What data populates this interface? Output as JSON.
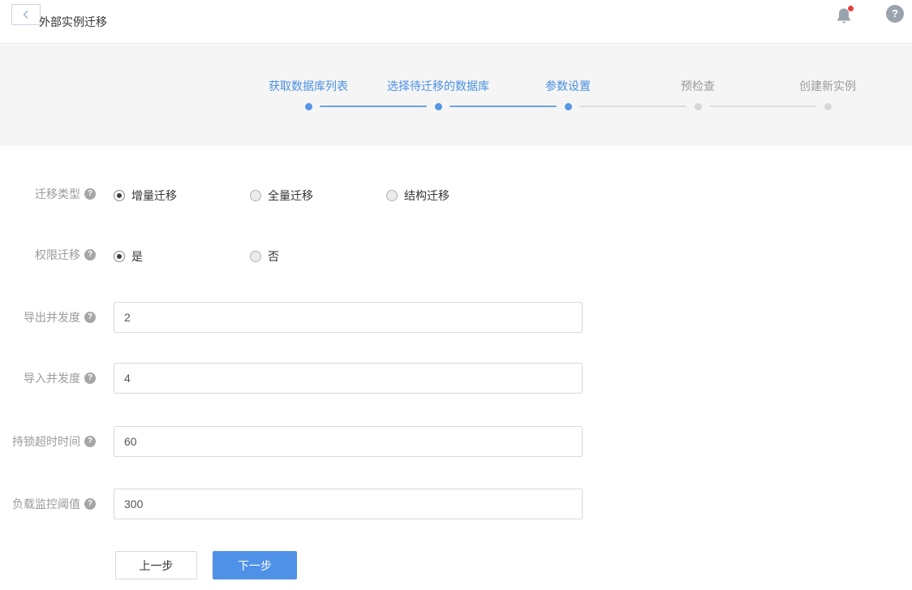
{
  "header": {
    "title": "外部实例迁移"
  },
  "icons": {
    "question_glyph": "?"
  },
  "colors": {
    "accent_blue": "#4a90e2",
    "step_inactive_gray": "#d6d6d6",
    "band_background": "#f5f5f6",
    "next_button_blue": "#5091e8",
    "notification_badge_red": "#e8413c"
  },
  "stepper": {
    "steps": [
      {
        "label": "获取数据库列表",
        "state": "active"
      },
      {
        "label": "选择待迁移的数据库",
        "state": "active"
      },
      {
        "label": "参数设置",
        "state": "active"
      },
      {
        "label": "预检查",
        "state": "pending"
      },
      {
        "label": "创建新实例",
        "state": "pending"
      }
    ]
  },
  "form": {
    "migration_type": {
      "label": "迁移类型",
      "options": [
        {
          "label": "增量迁移",
          "selected": true
        },
        {
          "label": "全量迁移",
          "selected": false
        },
        {
          "label": "结构迁移",
          "selected": false
        }
      ]
    },
    "privilege_migration": {
      "label": "权限迁移",
      "options": [
        {
          "label": "是",
          "selected": true
        },
        {
          "label": "否",
          "selected": false
        }
      ]
    },
    "export_concurrency": {
      "label": "导出并发度",
      "value": "2"
    },
    "import_concurrency": {
      "label": "导入并发度",
      "value": "4"
    },
    "lock_timeout": {
      "label": "持锁超时时间",
      "value": "60"
    },
    "load_threshold": {
      "label": "负载监控阈值",
      "value": "300"
    }
  },
  "buttons": {
    "previous": "上一步",
    "next": "下一步"
  }
}
